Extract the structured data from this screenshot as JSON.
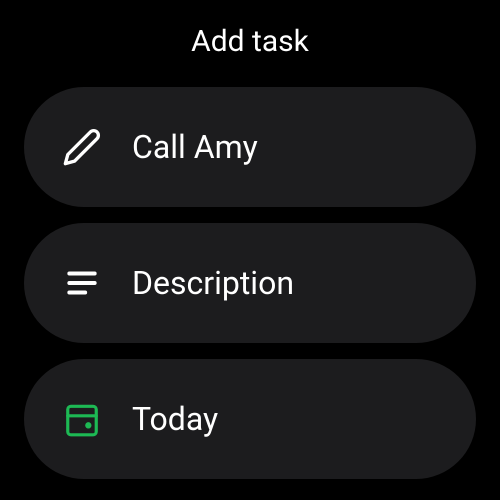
{
  "header": {
    "title": "Add task"
  },
  "items": [
    {
      "label": "Call Amy"
    },
    {
      "label": "Description"
    },
    {
      "label": "Today"
    }
  ]
}
